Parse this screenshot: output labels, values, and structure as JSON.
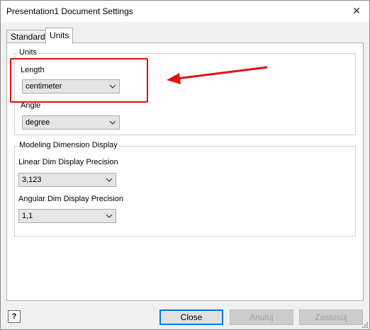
{
  "window": {
    "title": "Presentation1 Document Settings",
    "close_icon": "close-icon"
  },
  "tabs": [
    {
      "label": "Standard",
      "active": false
    },
    {
      "label": "Units",
      "active": true
    }
  ],
  "units_group": {
    "label": "Units",
    "length": {
      "label": "Length",
      "value": "centimeter"
    },
    "angle": {
      "label": "Angle",
      "value": "degree"
    }
  },
  "modeling_group": {
    "label": "Modeling Dimension Display",
    "linear": {
      "label": "Linear Dim Display Precision",
      "value": "3,123"
    },
    "angular": {
      "label": "Angular Dim Display Precision",
      "value": "1,1"
    }
  },
  "annotation": {
    "color": "#e31010"
  },
  "footer": {
    "help_label": "?",
    "close_label": "Close",
    "apply_label": "Anuluj",
    "ok_label": "Zastosuj"
  }
}
